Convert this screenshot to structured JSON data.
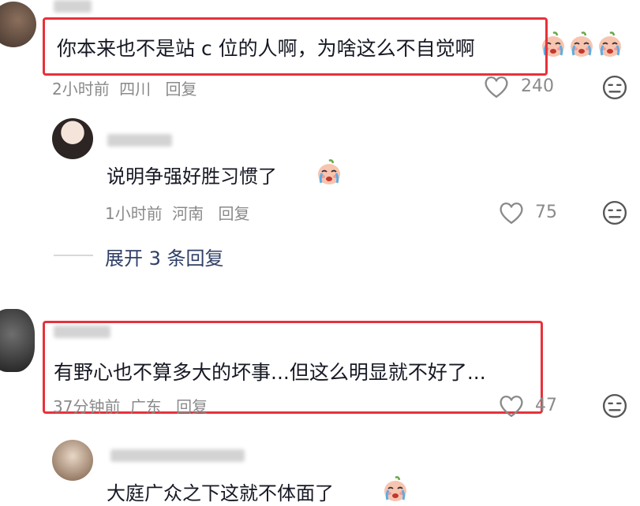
{
  "comments": [
    {
      "text": "你本来也不是站 c 位的人啊，为啥这么不自觉啊",
      "emoji": "crying-face-emoji",
      "emoji_count": 3,
      "time": "2小时前",
      "location": "四川",
      "reply_label": "回复",
      "likes": "240",
      "highlighted": true
    },
    {
      "text": "说明争强好胜习惯了",
      "emoji": "crying-face-emoji",
      "emoji_count": 1,
      "time": "1小时前",
      "location": "河南",
      "reply_label": "回复",
      "likes": "75",
      "highlighted": false,
      "is_reply": true
    },
    {
      "text": "有野心也不算多大的坏事...但这么明显就不好了...",
      "time": "37分钟前",
      "location": "广东",
      "reply_label": "回复",
      "likes": "47",
      "highlighted": true
    },
    {
      "text": "大庭广众之下这就不体面了",
      "emoji": "crying-face-emoji",
      "emoji_count": 1,
      "highlighted": false,
      "is_reply": true
    }
  ],
  "expand_replies": "展开 3 条回复",
  "colors": {
    "highlight_box": "#e8313a",
    "expand_link": "#2f3f66",
    "meta_text": "#8a8a8a",
    "comment_text": "#161823"
  }
}
